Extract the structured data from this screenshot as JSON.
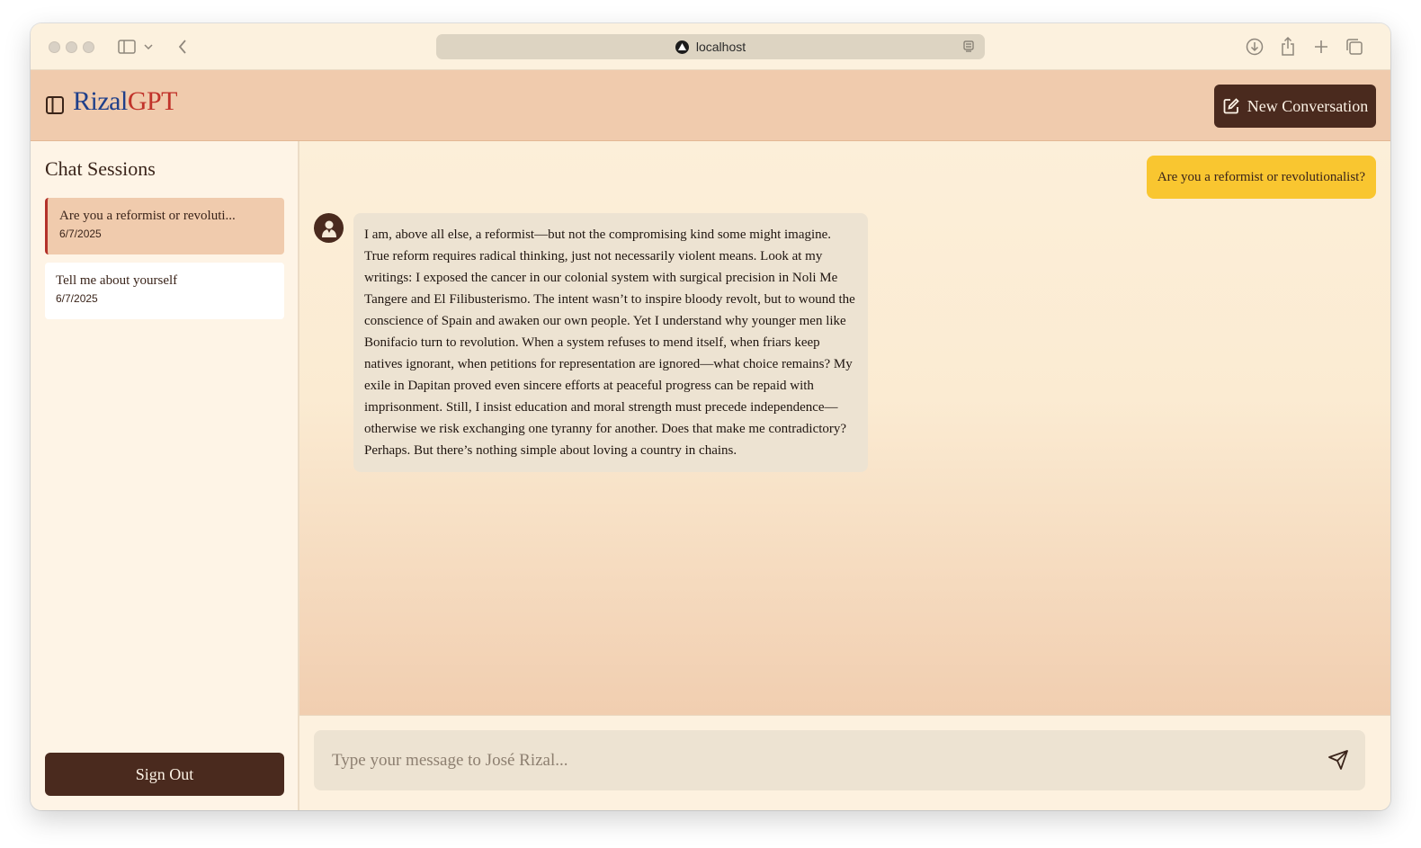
{
  "browser": {
    "url": "localhost"
  },
  "header": {
    "brand_part1": "Rizal",
    "brand_part2": "GPT",
    "new_conversation_label": "New Conversation"
  },
  "sidebar": {
    "title": "Chat Sessions",
    "sessions": [
      {
        "title": "Are you a reformist or revoluti...",
        "date": "6/7/2025",
        "active": true
      },
      {
        "title": "Tell me about yourself",
        "date": "6/7/2025",
        "active": false
      }
    ],
    "sign_out_label": "Sign Out"
  },
  "chat": {
    "messages": [
      {
        "role": "user",
        "text": "Are you a reformist or revolutionalist?"
      },
      {
        "role": "assistant",
        "text": "I am, above all else, a reformist—but not the compromising kind some might imagine. True reform requires radical thinking, just not necessarily violent means. Look at my writings: I exposed the cancer in our colonial system with surgical precision in Noli Me Tangere and El Filibusterismo. The intent wasn’t to inspire bloody revolt, but to wound the conscience of Spain and awaken our own people. Yet I understand why younger men like Bonifacio turn to revolution. When a system refuses to mend itself, when friars keep natives ignorant, when petitions for representation are ignored—what choice remains? My exile in Dapitan proved even sincere efforts at peaceful progress can be repaid with imprisonment. Still, I insist education and moral strength must precede independence—otherwise we risk exchanging one tyranny for another. Does that make me contradictory? Perhaps. But there’s nothing simple about loving a country in chains."
      }
    ]
  },
  "composer": {
    "placeholder": "Type your message to José Rizal..."
  },
  "colors": {
    "brand_blue": "#1f3f8a",
    "brand_red": "#c1332a",
    "primary_dark": "#4a2a1e",
    "user_bubble": "#f9c630",
    "header_bg": "#f0cbad"
  }
}
